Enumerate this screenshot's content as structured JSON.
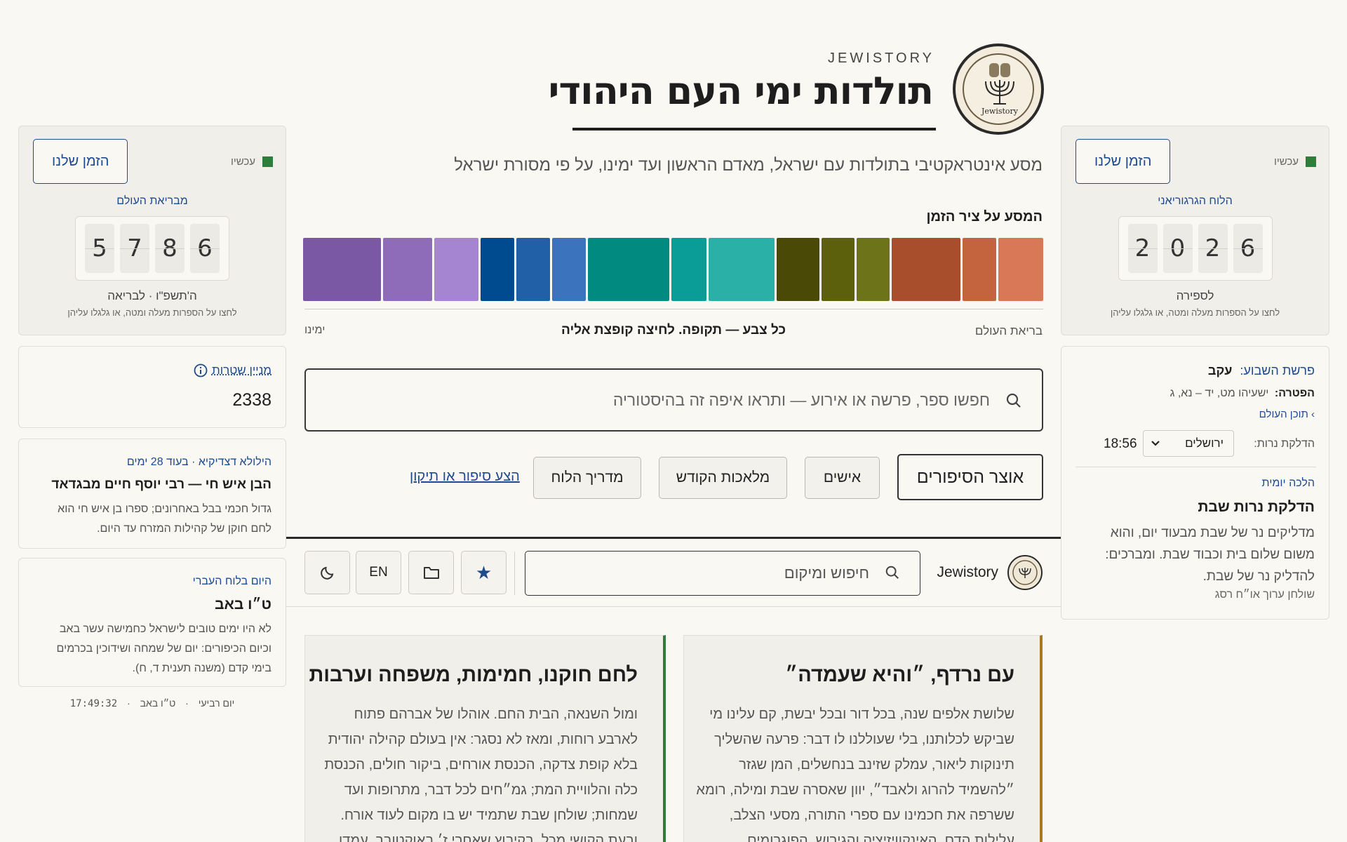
{
  "header": {
    "brand": "JEWISTORY",
    "title": "תולדות ימי העם היהודי",
    "subtitle": "מסע אינטראקטיבי בתולדות עם ישראל, מאדם הראשון ועד ימינו, על פי מסורת ישראל",
    "logo_text": "Jewistory"
  },
  "clock_gregorian": {
    "button": "הזמן שלנו",
    "now": "עכשיו",
    "label": "הלוח הגרגוריאני",
    "digits": [
      "2",
      "0",
      "2",
      "6"
    ],
    "era": "לספירה",
    "hint": "לחצו על הספרות מעלה ומטה, או גלגלו עליהן"
  },
  "clock_hebrew": {
    "button": "הזמן שלנו",
    "now": "עכשיו",
    "label": "מבריאת העולם",
    "digits": [
      "5",
      "7",
      "8",
      "6"
    ],
    "era": "ה'תשפ\"ו · לבריאה",
    "hint": "לחצו על הספרות מעלה ומטה, או גלגלו עליהן"
  },
  "timeline": {
    "heading": "המסע על ציר הזמן",
    "start": "בריאת העולם",
    "end": "ימינו",
    "caption": "כל צבע — תקופה. לחיצה קופצת אליה",
    "colors": [
      "#d97856",
      "#c4643f",
      "#a94e2c",
      "#6d7318",
      "#5c600d",
      "#4a4a06",
      "#2bb0a8",
      "#0a9c96",
      "#008a80",
      "#3b74bc",
      "#2160a6",
      "#004a8f",
      "#a584d2",
      "#8e6cba",
      "#7b58a4"
    ]
  },
  "search": {
    "placeholder": "חפשו ספר, פרשה או אירוע — ותראו איפה זה בהיסטוריה"
  },
  "nav": {
    "primary": "אוצר הסיפורים",
    "people": "אישים",
    "crafts": "מלאכות הקודש",
    "guide": "מדריך הלוח",
    "report": "הצע סיפור או תיקון"
  },
  "topbar": {
    "brand": "Jewistory",
    "search_placeholder": "חיפוש ומיקום",
    "lang": "EN"
  },
  "parasha": {
    "label": "פרשת השבוע:",
    "name": "עקב",
    "haftara_label": "הפטרה:",
    "haftara": "ישעיהו מט, יד – נא, ג",
    "toc": "› תוכן העולם",
    "candle_label": "הדלקת נרות:",
    "city": "ירושלים",
    "time": "18:56"
  },
  "halacha": {
    "label": "הלכה יומית",
    "title": "הדלקת נרות שבת",
    "body_lines": [
      "מדליקים נר של שבת מבעוד יום, והוא",
      "משום שלום בית וכבוד שבת. ומברכים:",
      "להדליק נר של שבת."
    ],
    "source": "שולחן ערוך או״ח רסג"
  },
  "counter": {
    "label": "מניין שטרות",
    "value": "2338"
  },
  "hillula": {
    "label": "הילולא דצדיקיא · בעוד 28 ימים",
    "title": "הבן איש חי — רבי יוסף חיים מבגדאד",
    "body_lines": [
      "גדול חכמי בבל באחרונים; ספרו בן איש חי הוא",
      "לחם חוקן של קהילות המזרח עד היום."
    ]
  },
  "hebrew_day": {
    "label": "היום בלוח העברי",
    "title": "ט״ו באב",
    "body_lines": [
      "לא היו ימים טובים לישראל כחמישה עשר באב",
      "וכיום הכיפורים: יום של שמחה ושידוכין בכרמים",
      "בימי קדם (משנה תענית ד, ח)."
    ]
  },
  "status": {
    "day": "יום רביעי",
    "date": "ט״ו באב",
    "time": "17:49:32"
  },
  "cards": [
    {
      "title": "עם נרדף, ״והיא שעמדה״",
      "accent": "#a8781e",
      "lines": [
        "שלושת אלפים שנה, בכל דור ובכל יבשת, קם עלינו מי",
        "שביקש לכלותנו, בלי שעוללנו לו דבר: פרעה שהשליך",
        "תינוקות ליאור, עמלק שזינב בנחשלים, המן שגזר",
        "״להשמיד להרוג ולאבד״, יוון שאסרה שבת ומילה, רומא",
        "ששרפה את חכמינו עם ספרי התורה, מסעי הצלב,",
        "עלילות הדם, האינקוויזיציה והגירוש, הפוגרומים"
      ]
    },
    {
      "title": "לחם חוקנו, חמימות, משפחה וערבות",
      "accent": "#2e7d3a",
      "lines": [
        "ומול השנאה, הבית החם. אוהלו של אברהם פתוח",
        "לארבע רוחות, ומאז לא נסגר: אין בעולם קהילה יהודית",
        "בלא קופת צדקה, הכנסת אורחים, ביקור חולים, הכנסת",
        "כלה והלוויית המת; גמ״חים לכל דבר, מתרופות ועד",
        "שמחות; שולחן שבת שתמיד יש בו מקום לעוד אורח.",
        "ובעת הקושי מכל, בקיבוץ שאחרי ז׳ באוקטובר, עמדו"
      ]
    }
  ]
}
